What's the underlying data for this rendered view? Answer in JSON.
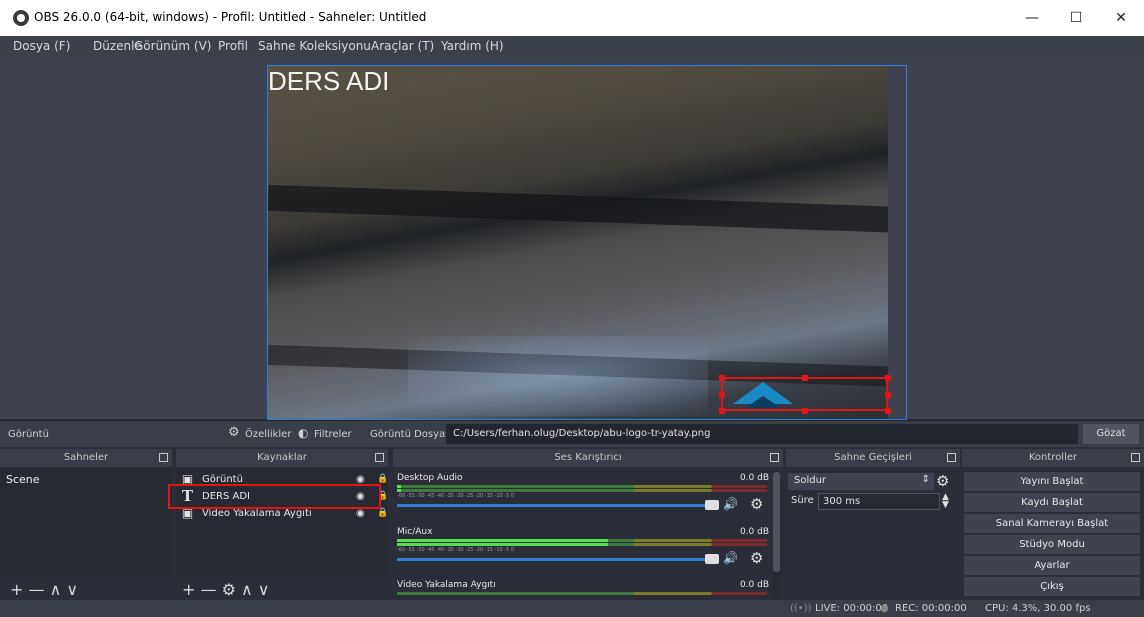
{
  "window": {
    "title": "OBS 26.0.0 (64-bit, windows) - Profil: Untitled - Sahneler: Untitled",
    "minimize": "—",
    "maximize": "☐",
    "close": "✕"
  },
  "menu": [
    "Dosya (F)",
    "Düzenle",
    "Görünüm (V)",
    "Profil",
    "Sahne Koleksiyonu",
    "Araçlar (T)",
    "Yardım (H)"
  ],
  "preview": {
    "overlay_text": "DERS ADI"
  },
  "propbar": {
    "source_label": "Görüntü",
    "properties": "Özellikler",
    "filters": "Filtreler",
    "file_label": "Görüntü Dosyası",
    "file_path": "C:/Users/ferhan.olug/Desktop/abu-logo-tr-yatay.png",
    "browse": "Gözat"
  },
  "docks": {
    "scenes": "Sahneler",
    "sources": "Kaynaklar",
    "mixer": "Ses Karıştırıcı",
    "transitions": "Sahne Geçişleri",
    "controls": "Kontroller"
  },
  "scenes": [
    "Scene"
  ],
  "sources": [
    {
      "name": "Görüntü",
      "icon": "image-icon"
    },
    {
      "name": "DERS ADI",
      "icon": "text-icon"
    },
    {
      "name": "Video Yakalama Aygıtı",
      "icon": "camera-icon"
    }
  ],
  "toolbar": {
    "scenes_controls": "+ — ∧ ∨",
    "sources_controls": "+ — ⚙ ∧ ∨"
  },
  "mixer": [
    {
      "name": "Desktop Audio",
      "db": "0.0 dB",
      "level": 0.01
    },
    {
      "name": "Mic/Aux",
      "db": "0.0 dB",
      "level": 0.57
    },
    {
      "name": "Video Yakalama Aygıtı",
      "db": "0.0 dB",
      "level": 0.0
    }
  ],
  "mixer_scale": "-60  -55  -50  -45  -40  -35  -30  -25  -20  -15  -10  -5  0",
  "transitions": {
    "selected": "Soldur",
    "duration_label": "Süre",
    "duration_value": "300 ms"
  },
  "controls": [
    "Yayını Başlat",
    "Kaydı Başlat",
    "Sanal Kamerayı Başlat",
    "Stüdyo Modu",
    "Ayarlar",
    "Çıkış"
  ],
  "status": {
    "live": "LIVE: 00:00:00",
    "rec": "REC: 00:00:00",
    "cpu": "CPU: 4.3%, 30.00 fps"
  },
  "colors": {
    "accent": "#2f7fd6",
    "highlight": "#e01515",
    "panel": "#272a33",
    "header": "#3a3e49"
  }
}
